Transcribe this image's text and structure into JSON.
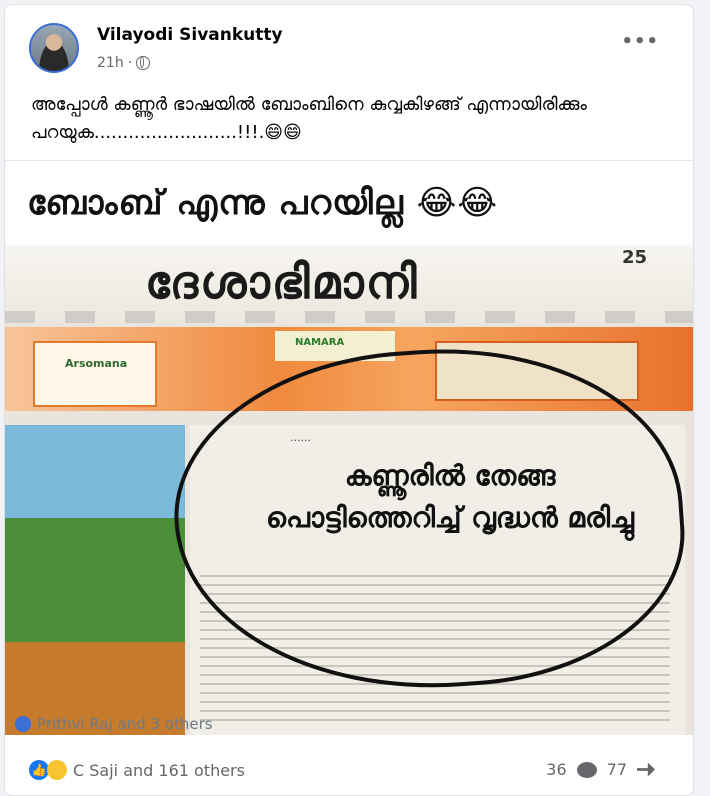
{
  "post": {
    "author": "Vilayodi Sivankutty",
    "time": "21h",
    "more_label": "•••",
    "caption": "അപ്പോൾ കണ്ണൂർ ഭാഷയിൽ ബോംബിനെ കുവ്വകിഴങ്ങ് എന്നായിരിക്കും പറയുക.........................!!!.😄😄"
  },
  "image_text": {
    "headline": "ബോംബ് എന്നു പറയില്ല 😂😂",
    "masthead": "ദേശാഭിമാനി",
    "date": "25",
    "ad_brand": "Arsomana",
    "ad_logo": "NAMARA",
    "story_headline_line1": "കണ്ണൂരിൽ തേങ്ങ",
    "story_headline_line2": "പൊട്ടിത്തെറിച്ച് വൃദ്ധൻ മരിച്ചു",
    "overlay_names": "Prithvi Raj and 3 others"
  },
  "footer": {
    "reactions_text": "C Saji and 161 others",
    "comments_count": "36",
    "shares_count": "77"
  },
  "icons": {
    "privacy": "globe-icon",
    "like": "like-reaction-icon",
    "haha": "haha-reaction-icon",
    "comment": "comment-icon",
    "share": "share-icon"
  }
}
